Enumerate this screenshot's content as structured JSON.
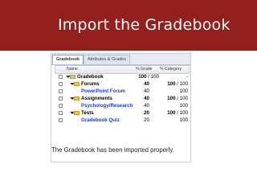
{
  "slide": {
    "title": "Import the Gradebook"
  },
  "tabs": [
    {
      "label": "Gradebook"
    },
    {
      "label": "Attributes & Grades"
    }
  ],
  "columns": {
    "name": "Name",
    "grade": "% Grade",
    "category": "% Category"
  },
  "rows": [
    {
      "name": "Gradebook",
      "grade_bold": "100",
      "grade_rest": " / 100",
      "category_bold": "",
      "category_rest": "-"
    },
    {
      "name": "Forums",
      "grade_bold": "40",
      "grade_rest": "",
      "category_bold": "100",
      "category_rest": " / 100"
    },
    {
      "name": "PowerPoint Forum",
      "grade_bold": "",
      "grade_rest": "40",
      "category_bold": "",
      "category_rest": "100"
    },
    {
      "name": "Assignments",
      "grade_bold": "40",
      "grade_rest": "",
      "category_bold": "100",
      "category_rest": " / 100"
    },
    {
      "name": "Psychology/Research",
      "grade_bold": "",
      "grade_rest": "40",
      "category_bold": "",
      "category_rest": "100"
    },
    {
      "name": "Tests",
      "grade_bold": "20",
      "grade_rest": "",
      "category_bold": "100",
      "category_rest": " / 100"
    },
    {
      "name": "Gradebook Quiz",
      "grade_bold": "",
      "grade_rest": "20",
      "category_bold": "",
      "category_rest": "100"
    }
  ],
  "caption": "The Gradebook has been imported properly.",
  "colors": {
    "banner": "#93201d",
    "link": "#1a3ccf",
    "folder": "#e9c55b"
  }
}
